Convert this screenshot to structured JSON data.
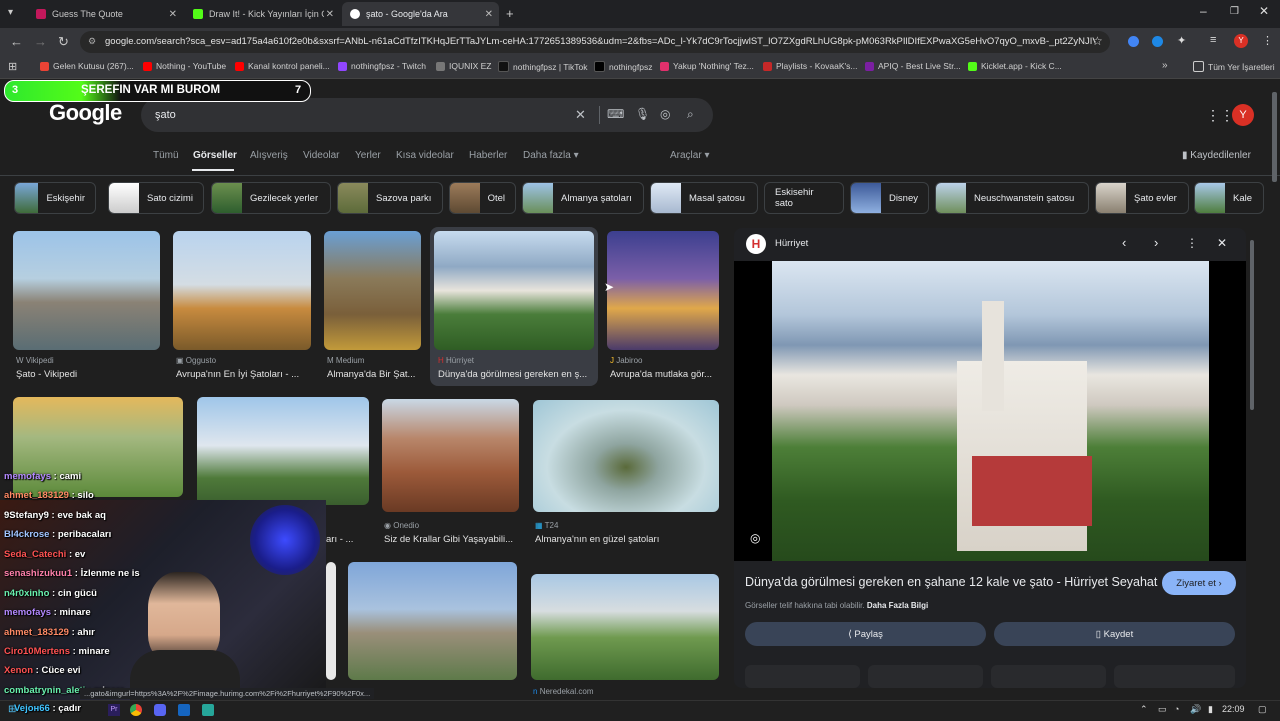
{
  "browser": {
    "tabs": [
      {
        "title": "Guess The Quote",
        "color": "#c2185b"
      },
      {
        "title": "Draw It! - Kick Yayınları İçin Çizi",
        "color": "#53fc18"
      },
      {
        "title": "şato - Google'da Ara",
        "color": "#ffffff"
      }
    ],
    "url": "google.com/search?sca_esv=ad175a4a610f2e0b&sxsrf=ANbL-n61aCdTfzITKHqJErTTaJYLm-ceHA:1772651389536&udm=2&fbs=ADc_l-Yk7dC9rTocjjwlST_lO7ZXgdRLhUG8pk-pM063RkPIlDIfEXPwaXG5eHvO7qyO_mxvB-_pt2ZyNJIVa-ipFU...",
    "bookmarks": [
      {
        "label": "Gelen Kutusu (267)...",
        "color": "#ea4335"
      },
      {
        "label": "Nothing - YouTube",
        "color": "#ff0000"
      },
      {
        "label": "Kanal kontrol paneli...",
        "color": "#ff0000"
      },
      {
        "label": "nothingfpsz - Twitch",
        "color": "#9146ff"
      },
      {
        "label": "IQUNIX EZ",
        "color": "#777777"
      },
      {
        "label": "nothingfpsz | TikTok",
        "color": "#111111"
      },
      {
        "label": "nothingfpsz",
        "color": "#000000"
      },
      {
        "label": "Yakup 'Nothing' Tez...",
        "color": "#e1306c"
      },
      {
        "label": "Playlists - KovaaK's...",
        "color": "#c62828"
      },
      {
        "label": "APIQ - Best Live Str...",
        "color": "#7b1fa2"
      },
      {
        "label": "Kicklet.app - Kick C...",
        "color": "#53fc18"
      }
    ],
    "all_bookmarks": "Tüm Yer İşaretleri"
  },
  "overlay_bar": {
    "left_num": "3",
    "text": "ŞEREFIN VAR MI BUROM",
    "right_num": "7"
  },
  "google": {
    "logo": "Google",
    "query": "şato",
    "tabs": [
      "Tümü",
      "Görseller",
      "Alışveriş",
      "Videolar",
      "Yerler",
      "Kısa videolar",
      "Haberler",
      "Daha fazla"
    ],
    "tools": "Araçlar",
    "saved": "Kaydedilenler",
    "avatar": "Y"
  },
  "chips": [
    "Eskişehir",
    "Sato cizimi",
    "Gezilecek yerler",
    "Sazova parkı",
    "Otel",
    "Almanya şatoları",
    "Masal şatosu",
    "Eskisehir sato",
    "Disney",
    "Neuschwanstein şatosu",
    "Şato evler",
    "Kale"
  ],
  "results": [
    {
      "source": "Vikipedi",
      "caption": "Şato - Vikipedi"
    },
    {
      "source": "Oggusto",
      "caption": "Avrupa'nın En İyi Şatoları - ..."
    },
    {
      "source": "Medium",
      "caption": "Almanya'da Bir Şat..."
    },
    {
      "source": "Hürriyet",
      "caption": "Dünya'da görülmesi gereken en ş..."
    },
    {
      "source": "Jabiroo",
      "caption": "Avrupa'da mutlaka gör..."
    },
    {
      "source": "",
      "caption": ""
    },
    {
      "source": "",
      "caption": "arı - ..."
    },
    {
      "source": "Onedio",
      "caption": "Siz de Krallar Gibi Yaşayabili..."
    },
    {
      "source": "T24",
      "caption": "Almanya'nın en güzel şatoları"
    },
    {
      "source": "Neredekal.com",
      "caption": ""
    }
  ],
  "panel": {
    "source": "Hürriyet",
    "title": "Dünya'da görülmesi gereken en şahane 12 kale ve şato - Hürriyet Seyahat",
    "visit": "Ziyaret et",
    "copyright": "Görseller telif hakkına tabi olabilir.",
    "more_info": "Daha Fazla Bilgi",
    "share": "Paylaş",
    "save": "Kaydet"
  },
  "chat": [
    {
      "user": "memofays",
      "msg": "cami",
      "color": "#b388ff"
    },
    {
      "user": "ahmet_183129",
      "msg": "silo",
      "color": "#ff8a65"
    },
    {
      "user": "9Stefany9",
      "msg": "eve bak aq",
      "color": "#ffffff"
    },
    {
      "user": "Bl4ckrose",
      "msg": "peribacaları",
      "color": "#a0c4ff"
    },
    {
      "user": "Seda_Catechi",
      "msg": "ev",
      "color": "#ff5252"
    },
    {
      "user": "senashizukuu1",
      "msg": "İzlenme ne is",
      "color": "#ff80ab"
    },
    {
      "user": "n4r0xinho",
      "msg": "cin gücü",
      "color": "#69f0ae"
    },
    {
      "user": "memofays",
      "msg": "minare",
      "color": "#b388ff"
    },
    {
      "user": "ahmet_183129",
      "msg": "ahır",
      "color": "#ff8a65"
    },
    {
      "user": "Ciro10Mertens",
      "msg": "minare",
      "color": "#ff5252"
    },
    {
      "user": "Xenon",
      "msg": "Cüce evi",
      "color": "#ff5252"
    },
    {
      "user": "combatrynin_aleti",
      "msg": "minare",
      "color": "#69f0ae"
    },
    {
      "user": "Vejoн66",
      "msg": "çadır",
      "color": "#40c4ff"
    }
  ],
  "status_url": "...gato&imgurl=https%3A%2F%2Fimage.hurimg.com%2Fi%2Fhurriyet%2F90%2F0x...",
  "taskbar": {
    "time": "22:09"
  }
}
